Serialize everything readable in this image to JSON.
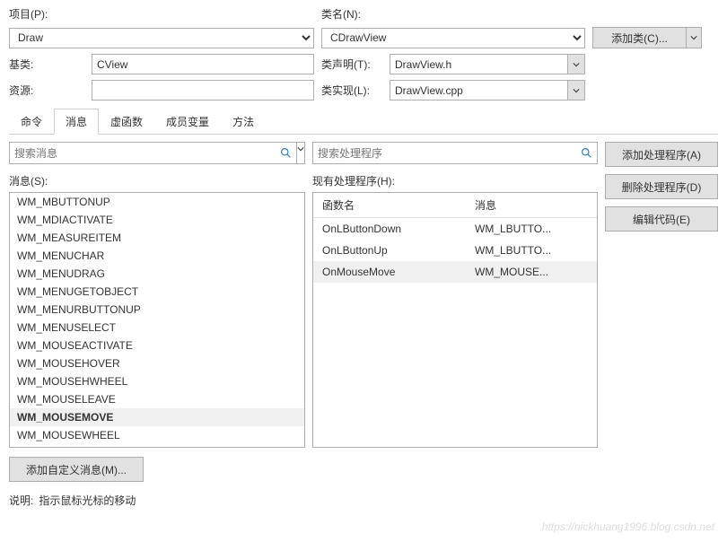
{
  "labels": {
    "project": "项目(P):",
    "class_name": "类名(N):",
    "base_class": "基类:",
    "class_decl": "类声明(T):",
    "resource": "资源:",
    "class_impl": "类实现(L):",
    "add_class": "添加类(C)...",
    "messages_s": "消息(S):",
    "existing_handlers": "现有处理程序(H):",
    "func_name": "函数名",
    "message": "消息",
    "add_handler": "添加处理程序(A)",
    "del_handler": "删除处理程序(D)",
    "edit_code": "编辑代码(E)",
    "add_custom_msg": "添加自定义消息(M)...",
    "desc_label": "说明:",
    "desc_text": "指示鼠标光标的移动"
  },
  "placeholders": {
    "search_msg": "搜索消息",
    "search_handler": "搜索处理程序"
  },
  "values": {
    "project": "Draw",
    "class_name": "CDrawView",
    "base_class": "CView",
    "class_decl": "DrawView.h",
    "resource": "",
    "class_impl": "DrawView.cpp"
  },
  "tabs": [
    "命令",
    "消息",
    "虚函数",
    "成员变量",
    "方法"
  ],
  "active_tab": 1,
  "messages": [
    "WM_MBUTTONUP",
    "WM_MDIACTIVATE",
    "WM_MEASUREITEM",
    "WM_MENUCHAR",
    "WM_MENUDRAG",
    "WM_MENUGETOBJECT",
    "WM_MENURBUTTONUP",
    "WM_MENUSELECT",
    "WM_MOUSEACTIVATE",
    "WM_MOUSEHOVER",
    "WM_MOUSEHWHEEL",
    "WM_MOUSELEAVE",
    "WM_MOUSEMOVE",
    "WM_MOUSEWHEEL"
  ],
  "selected_message": "WM_MOUSEMOVE",
  "handlers": [
    {
      "func": "OnLButtonDown",
      "msg": "WM_LBUTTO..."
    },
    {
      "func": "OnLButtonUp",
      "msg": "WM_LBUTTO..."
    },
    {
      "func": "OnMouseMove",
      "msg": "WM_MOUSE..."
    }
  ],
  "selected_handler": 2,
  "watermark": "https://nickhuang1996.blog.csdn.net"
}
